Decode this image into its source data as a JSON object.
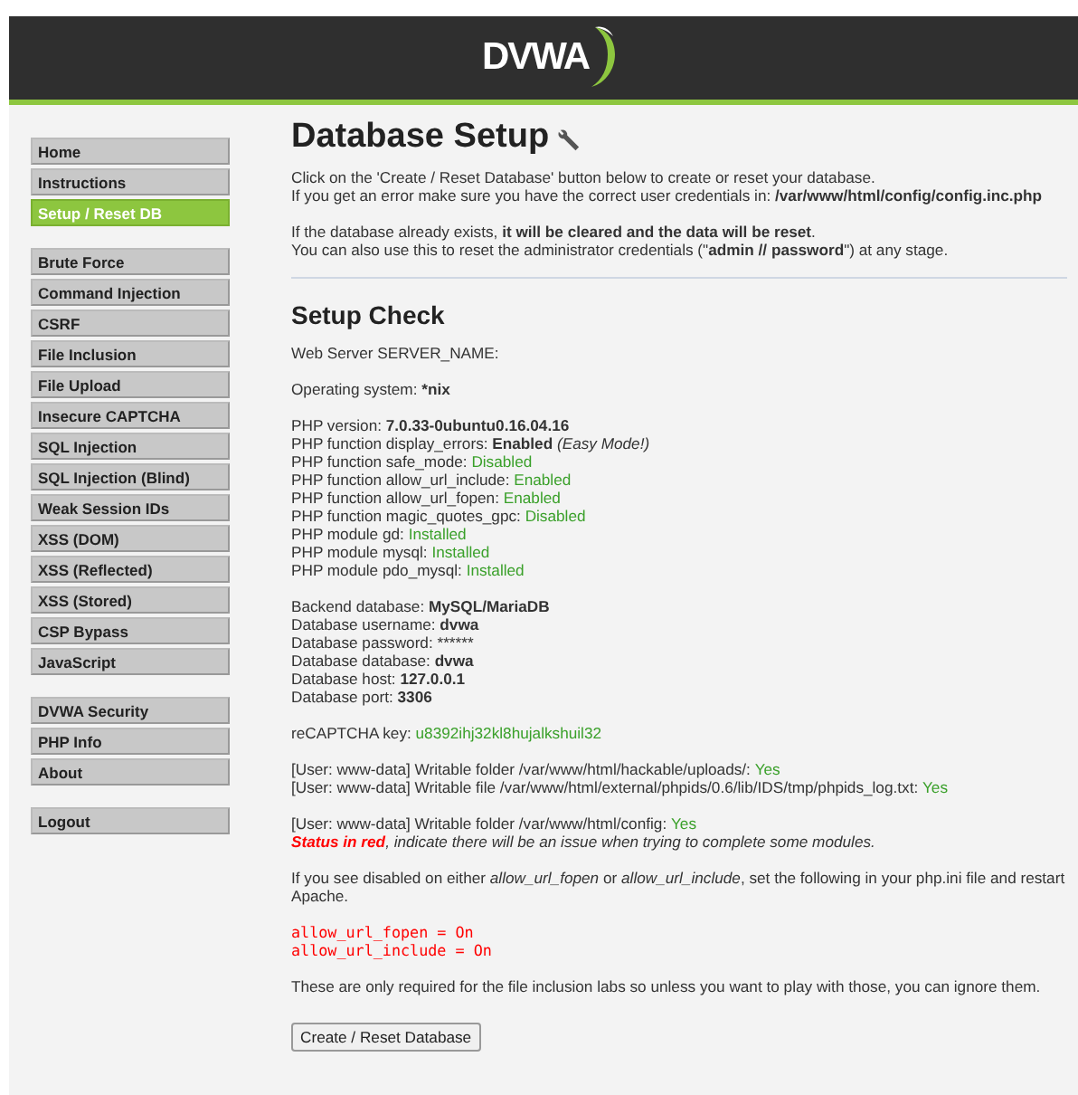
{
  "header": {
    "logo": "DVWA"
  },
  "sidebar": {
    "groups": [
      [
        {
          "label": "Home",
          "selected": false
        },
        {
          "label": "Instructions",
          "selected": false
        },
        {
          "label": "Setup / Reset DB",
          "selected": true
        }
      ],
      [
        {
          "label": "Brute Force",
          "selected": false
        },
        {
          "label": "Command Injection",
          "selected": false
        },
        {
          "label": "CSRF",
          "selected": false
        },
        {
          "label": "File Inclusion",
          "selected": false
        },
        {
          "label": "File Upload",
          "selected": false
        },
        {
          "label": "Insecure CAPTCHA",
          "selected": false
        },
        {
          "label": "SQL Injection",
          "selected": false
        },
        {
          "label": "SQL Injection (Blind)",
          "selected": false
        },
        {
          "label": "Weak Session IDs",
          "selected": false
        },
        {
          "label": "XSS (DOM)",
          "selected": false
        },
        {
          "label": "XSS (Reflected)",
          "selected": false
        },
        {
          "label": "XSS (Stored)",
          "selected": false
        },
        {
          "label": "CSP Bypass",
          "selected": false
        },
        {
          "label": "JavaScript",
          "selected": false
        }
      ],
      [
        {
          "label": "DVWA Security",
          "selected": false
        },
        {
          "label": "PHP Info",
          "selected": false
        },
        {
          "label": "About",
          "selected": false
        }
      ],
      [
        {
          "label": "Logout",
          "selected": false
        }
      ]
    ]
  },
  "title": "Database Setup",
  "intro": [
    [
      "Click on the 'Create / Reset Database' button below to create or reset your database.",
      "If you get an error make sure you have the correct user credentials in: **/var/www/html/config/config.inc.php**"
    ],
    [
      "If the database already exists, **it will be cleared and the data will be reset**.",
      "You can also use this to reset the administrator credentials (\"**admin // password**\") at any stage."
    ]
  ],
  "check_title": "Setup Check",
  "blocks": [
    [
      {
        "kind": "plain",
        "text": "Web Server SERVER_NAME:"
      }
    ],
    [
      {
        "kind": "plain",
        "text": "Operating system: ***nix**"
      }
    ],
    [
      {
        "kind": "plain",
        "text": "PHP version: **7.0.33-0ubuntu0.16.04.16**"
      },
      {
        "kind": "plain",
        "text": "PHP function display_errors: **Enabled** *(Easy Mode!)*"
      },
      {
        "kind": "status",
        "text": "PHP function safe_mode: ",
        "status": "Disabled"
      },
      {
        "kind": "status",
        "text": "PHP function allow_url_include: ",
        "status": "Enabled"
      },
      {
        "kind": "status",
        "text": "PHP function allow_url_fopen: ",
        "status": "Enabled"
      },
      {
        "kind": "status",
        "text": "PHP function magic_quotes_gpc: ",
        "status": "Disabled"
      },
      {
        "kind": "status",
        "text": "PHP module gd: ",
        "status": "Installed"
      },
      {
        "kind": "status",
        "text": "PHP module mysql: ",
        "status": "Installed"
      },
      {
        "kind": "status",
        "text": "PHP module pdo_mysql: ",
        "status": "Installed"
      }
    ],
    [
      {
        "kind": "plain",
        "text": "Backend database: **MySQL/MariaDB**"
      },
      {
        "kind": "plain",
        "text": "Database username: **dvwa**"
      },
      {
        "kind": "raw",
        "text": "Database password: ******"
      },
      {
        "kind": "plain",
        "text": "Database database: **dvwa**"
      },
      {
        "kind": "plain",
        "text": "Database host: **127.0.0.1**"
      },
      {
        "kind": "plain",
        "text": "Database port: **3306**"
      }
    ],
    [
      {
        "kind": "status",
        "text": "reCAPTCHA key: ",
        "status": "u8392ihj32kl8hujalkshuil32"
      }
    ],
    [
      {
        "kind": "status",
        "text": "[User: www-data] Writable folder /var/www/html/hackable/uploads/: ",
        "status": "Yes"
      },
      {
        "kind": "status",
        "text": "[User: www-data] Writable file /var/www/html/external/phpids/0.6/lib/IDS/tmp/phpids_log.txt: ",
        "status": "Yes"
      }
    ],
    [
      {
        "kind": "status",
        "text": "[User: www-data] Writable folder /var/www/html/config: ",
        "status": "Yes"
      },
      {
        "kind": "warning",
        "text": "**Status in red**, indicate there will be an issue when trying to complete some modules."
      }
    ],
    [
      {
        "kind": "plain",
        "text": "If you see disabled on either *allow_url_fopen* or *allow_url_include*, set the following in your php.ini file and restart Apache."
      }
    ]
  ],
  "code": [
    "allow_url_fopen = On",
    "allow_url_include = On"
  ],
  "note": "These are only required for the file inclusion labs so unless you want to play with those, you can ignore them.",
  "button": "Create / Reset Database"
}
